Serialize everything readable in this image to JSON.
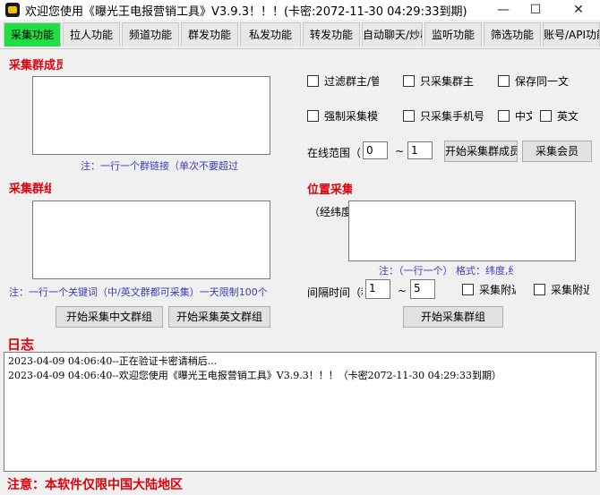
{
  "window": {
    "title": "欢迎您使用《曝光王电报营销工具》V3.9.3！！！(卡密:2072-11-30 04:29:33到期)",
    "minimize_glyph": "—",
    "maximize_glyph": "☐",
    "close_glyph": "✕"
  },
  "tabs": [
    {
      "label": "采集功能",
      "active": true
    },
    {
      "label": "拉人功能"
    },
    {
      "label": "频道功能"
    },
    {
      "label": "群发功能"
    },
    {
      "label": "私发功能"
    },
    {
      "label": "转发功能"
    },
    {
      "label": "自动聊天/炒群"
    },
    {
      "label": "监听功能"
    },
    {
      "label": "筛选功能"
    },
    {
      "label": "账号/API功能"
    }
  ],
  "collect_group_members": {
    "title": "采集群成员",
    "note": "注：一行一个群链接（单次不要超过"
  },
  "options": {
    "filter_admin": "过滤群主/管理",
    "only_owner": "只采集群主",
    "save_same": "保存同一文件",
    "force_collect": "强制采集模式",
    "only_phone": "只采集手机号",
    "chinese": "中文",
    "english": "英文",
    "online_range_label": "在线范围（",
    "online_from": "0",
    "tilde": "~",
    "online_to": "1",
    "start_members_btn": "开始采集群成员",
    "collect_members_btn": "采集会员"
  },
  "collect_groups": {
    "title": "采集群组",
    "note": "注：一行一个关键词（中/英文群都可采集）一天限制100个",
    "start_cn_btn": "开始采集中文群组",
    "start_en_btn": "开始采集英文群组"
  },
  "location_collect": {
    "title": "位置采集",
    "latlng_label": "（经纬度）",
    "note": "注：（一行一个） 格式：纬度,经度",
    "interval_label": "间隔时间（秒）",
    "interval_from": "1",
    "interval_tilde": "~",
    "interval_to": "5",
    "nearby_a": "采集附近群",
    "nearby_b": "采集附近人",
    "start_btn": "开始采集群组"
  },
  "log": {
    "title": "日志",
    "lines": [
      "2023-04-09 04:06:40--正在验证卡密请稍后...",
      "2023-04-09 04:06:40--欢迎您使用《曝光王电报营销工具》V3.9.3！！！（卡密2072-11-30 04:29:33到期）"
    ]
  },
  "footer": {
    "note": "注意：本软件仅限中国大陆地区"
  },
  "colors": {
    "active_tab": "#22dd44",
    "red_title": "#e0000a",
    "note_blue": "#3b3bc4"
  }
}
